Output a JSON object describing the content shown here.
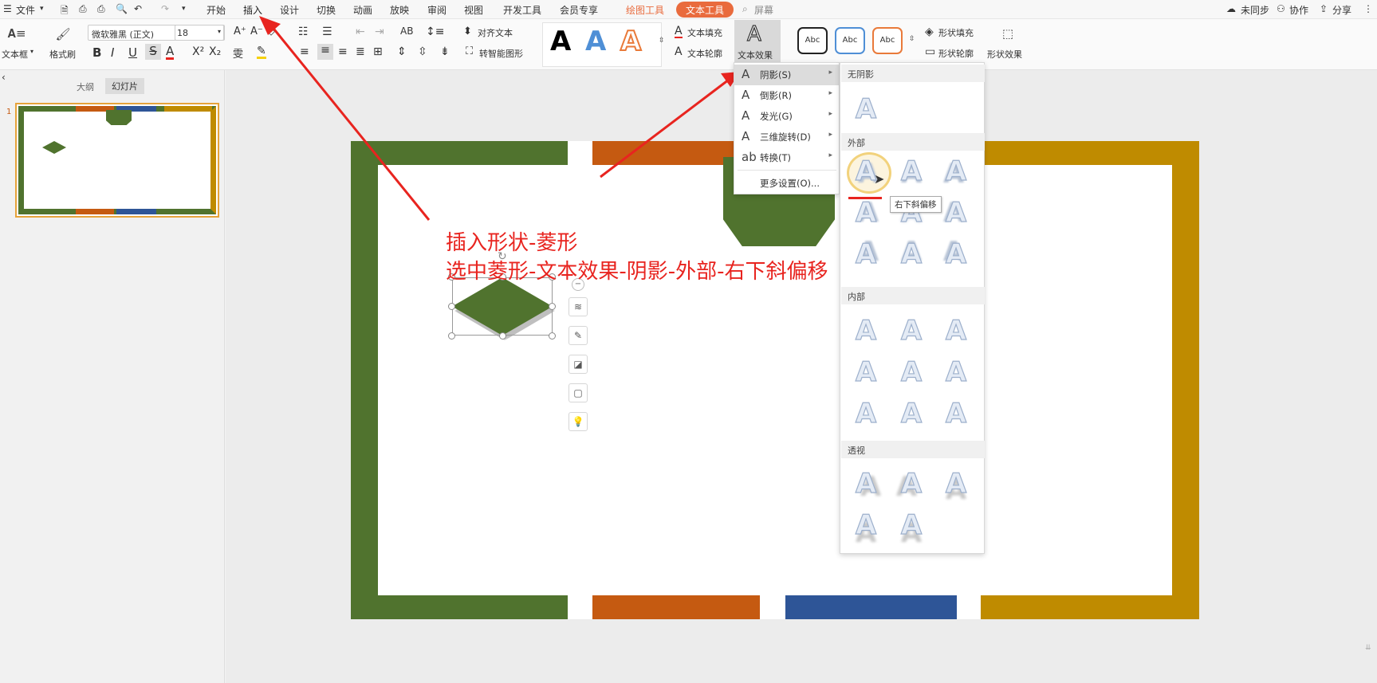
{
  "menubar": {
    "file": "文件",
    "tabs": [
      "开始",
      "插入",
      "设计",
      "切换",
      "动画",
      "放映",
      "审阅",
      "视图",
      "开发工具",
      "会员专享"
    ],
    "drawing_tools": "绘图工具",
    "text_tools": "文本工具",
    "search": "屏幕",
    "sync": "未同步",
    "collab": "协作",
    "share": "分享"
  },
  "ribbon": {
    "textbox": "文本框",
    "format_painter": "格式刷",
    "font_name": "微软雅黑 (正文)",
    "font_size": "18",
    "align_text": "对齐文本",
    "smart_shape": "转智能图形",
    "text_fill": "文本填充",
    "text_outline": "文本轮廓",
    "text_effect": "文本效果",
    "style_sample": "Abc",
    "shape_fill": "形状填充",
    "shape_outline": "形状轮廓",
    "shape_effect": "形状效果"
  },
  "left_pane": {
    "tab_outline": "大纲",
    "tab_slides": "幻灯片",
    "slide_number": "1"
  },
  "annotation": {
    "line1": "插入形状-菱形",
    "line2": "选中菱形-文本效果-阴影-外部-右下斜偏移"
  },
  "effect_menu": {
    "items": [
      "阴影(S)",
      "倒影(R)",
      "发光(G)",
      "三维旋转(D)",
      "转换(T)"
    ],
    "more": "更多设置(O)..."
  },
  "shadow_panel": {
    "no_shadow": "无阴影",
    "outer": "外部",
    "inner": "内部",
    "perspective": "透视",
    "tooltip": "右下斜偏移",
    "glyph": "A"
  },
  "colors": {
    "green": "#50732e",
    "orange": "#c55a11",
    "blue": "#2e5597",
    "gold": "#bf8b00",
    "annotation_red": "#e8241f",
    "accent_orange": "#e96b3d"
  }
}
